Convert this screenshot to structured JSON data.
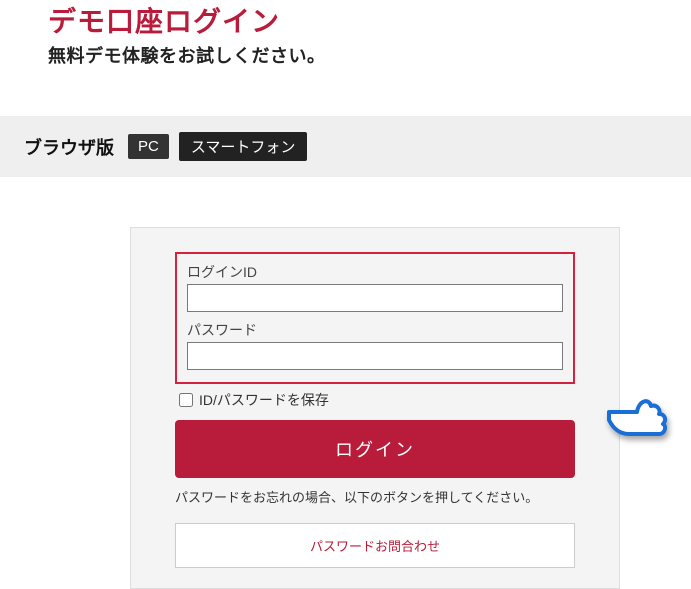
{
  "header": {
    "title": "デモ口座ログイン",
    "subtitle": "無料デモ体験をお試しください。"
  },
  "tabs": {
    "label": "ブラウザ版",
    "items": [
      "PC",
      "スマートフォン"
    ]
  },
  "login": {
    "id_label": "ログインID",
    "password_label": "パスワード",
    "remember_label": "ID/パスワードを保存",
    "login_button": "ログイン",
    "forgot_text": "パスワードをお忘れの場合、以下のボタンを押してください。",
    "contact_button": "パスワードお問合わせ"
  }
}
